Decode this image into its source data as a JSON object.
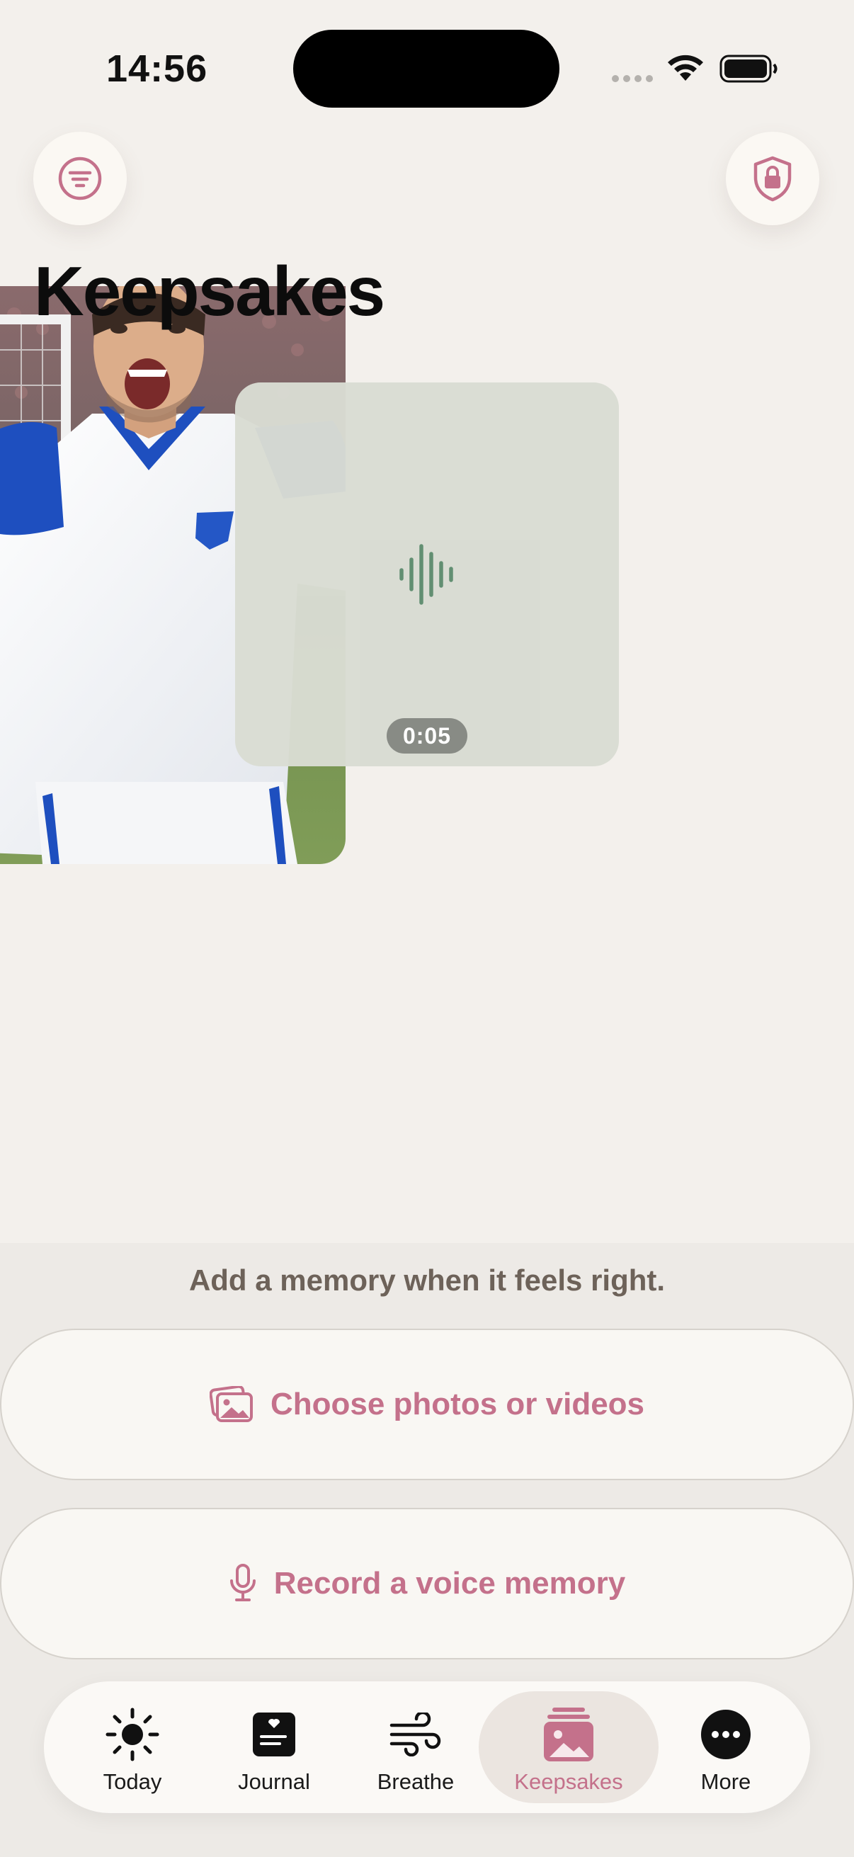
{
  "status_bar": {
    "time": "14:56"
  },
  "header": {
    "title": "Keepsakes",
    "filter_icon": "filter-lines-icon",
    "lock_icon": "shield-lock-icon"
  },
  "memories": {
    "photo": {
      "description_icon": "photo-thumbnail"
    },
    "voice": {
      "duration": "0:05",
      "icon": "waveform-icon"
    }
  },
  "add_panel": {
    "hint": "Add a memory when it feels right.",
    "photos_button": "Choose photos or videos",
    "voice_button": "Record a voice memory"
  },
  "tab_bar": {
    "items": [
      {
        "label": "Today",
        "icon": "sun-icon"
      },
      {
        "label": "Journal",
        "icon": "journal-icon"
      },
      {
        "label": "Breathe",
        "icon": "wind-icon"
      },
      {
        "label": "Keepsakes",
        "icon": "photo-stack-icon",
        "active": true
      },
      {
        "label": "More",
        "icon": "more-dots-icon"
      }
    ]
  },
  "colors": {
    "accent": "#c4718b",
    "background": "#f3f0ec",
    "voice_card": "#d9dcd3",
    "wave": "#5e8c6f"
  }
}
